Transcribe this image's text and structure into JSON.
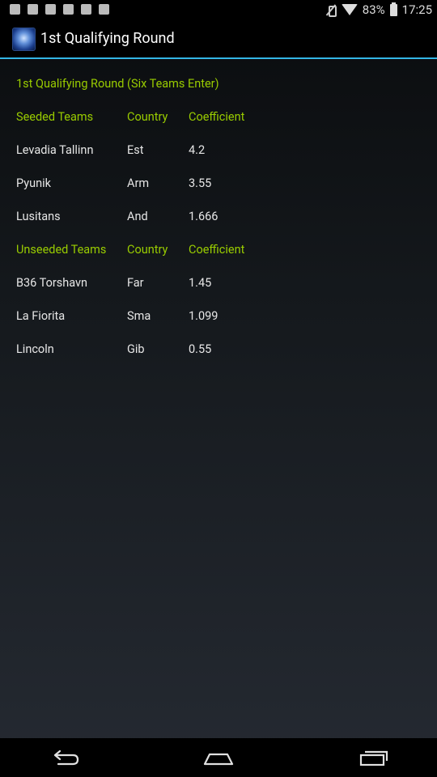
{
  "status_bar": {
    "battery_percent": "83%",
    "time": "17:25",
    "icons": [
      "chat-notification-icon",
      "image-notification-icon",
      "gmail-notification-icon",
      "facebook-notification-icon",
      "download-notification-icon",
      "shopping-notification-icon",
      "mute-icon",
      "wifi-icon",
      "battery-icon"
    ]
  },
  "action_bar": {
    "title": "1st Qualifying Round",
    "app_icon": "app-logo-icon"
  },
  "content": {
    "heading": "1st Qualifying Round (Six Teams Enter)",
    "seeded_header": {
      "team": "Seeded Teams",
      "country": "Country",
      "coefficient": "Coefficient"
    },
    "seeded": [
      {
        "team": "Levadia Tallinn",
        "country": "Est",
        "coefficient": "4.2"
      },
      {
        "team": "Pyunik",
        "country": "Arm",
        "coefficient": "3.55"
      },
      {
        "team": "Lusitans",
        "country": "And",
        "coefficient": "1.666"
      }
    ],
    "unseeded_header": {
      "team": "Unseeded Teams",
      "country": "Country",
      "coefficient": "Coefficient"
    },
    "unseeded": [
      {
        "team": "B36 Torshavn",
        "country": "Far",
        "coefficient": "1.45"
      },
      {
        "team": "La Fiorita",
        "country": "Sma",
        "coefficient": "1.099"
      },
      {
        "team": "Lincoln",
        "country": "Gib",
        "coefficient": "0.55"
      }
    ]
  },
  "nav_bar": {
    "buttons": [
      "back-icon",
      "home-icon",
      "recent-apps-icon"
    ]
  },
  "colors": {
    "accent_green": "#99cc00",
    "actionbar_divider": "#33b5e5",
    "text_primary": "#e6e6e6"
  }
}
